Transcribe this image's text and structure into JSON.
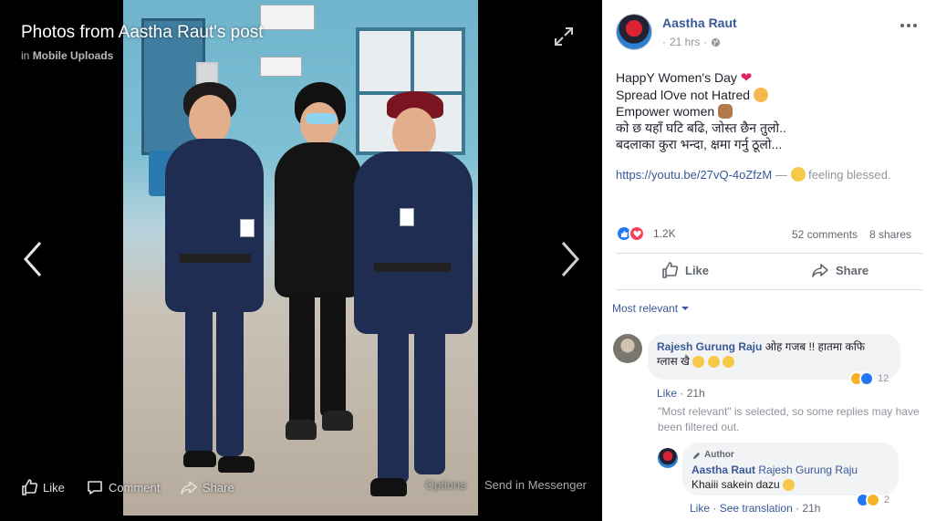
{
  "viewer": {
    "title": "Photos from Aastha Raut's post",
    "subtitle_prefix": "in",
    "subtitle_album": "Mobile Uploads",
    "actions": {
      "like": "Like",
      "comment": "Comment",
      "share": "Share",
      "options": "Options",
      "send": "Send in Messenger"
    }
  },
  "post": {
    "author": "Aastha Raut",
    "time": "21 hrs",
    "privacy_icon": "globe-icon",
    "text_lines": [
      "HappY Women's Day",
      "Spread lOve not Hatred",
      "Empower women",
      "को छ यहाँ घटि बढि, जोस्त छैन तुलो..",
      "बदलाका कुरा भन्दा, क्षमा गर्नु ठूलो..."
    ],
    "link": "https://youtu.be/27vQ-4oZfzM",
    "link_dash": "—",
    "feeling": "feeling blessed.",
    "reactions_count": "1.2K",
    "comments_count": "52 comments",
    "shares_count": "8 shares",
    "like_label": "Like",
    "share_label": "Share"
  },
  "comments": {
    "sort_label": "Most relevant",
    "items": [
      {
        "author": "Rajesh Gurung Raju",
        "text": "ओह गजब !! हातमा कफि",
        "text2": "ग्लास खै",
        "like_label": "Like",
        "time": "21h",
        "reaction_count": "12"
      }
    ],
    "filter_note": "\"Most relevant\" is selected, so some replies may have been filtered out.",
    "reply": {
      "tag": "Author",
      "author": "Aastha Raut",
      "mention": "Rajesh Gurung Raju",
      "text": "Khaiii sakein dazu",
      "like_label": "Like",
      "see_translation": "See translation",
      "time": "21h",
      "reaction_count": "2"
    }
  },
  "colors": {
    "link": "#385898",
    "like_blue": "#2078f4",
    "love_red": "#f33e58"
  }
}
